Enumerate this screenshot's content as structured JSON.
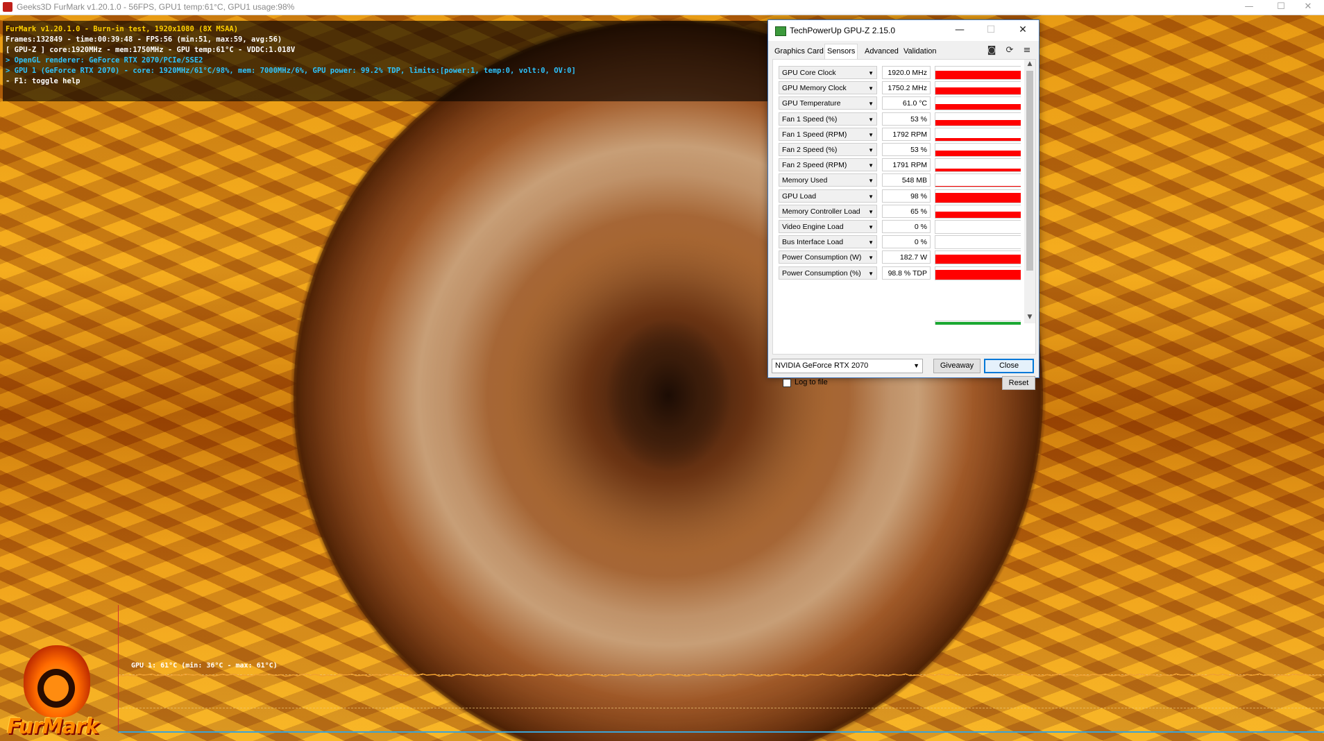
{
  "furmark": {
    "window_title": "Geeks3D FurMark v1.20.1.0 - 56FPS, GPU1 temp:61°C, GPU1 usage:98%",
    "osd": [
      {
        "text": "FurMark v1.20.1.0 - Burn-in test, 1920x1080 (8X MSAA)",
        "color": "#ffd000"
      },
      {
        "text": "Frames:132849 - time:00:39:48 - FPS:56 (min:51, max:59, avg:56)",
        "color": "#ffffff"
      },
      {
        "text": "[ GPU-Z ] core:1920MHz - mem:1750MHz - GPU temp:61°C - VDDC:1.018V",
        "color": "#ffffff"
      },
      {
        "text": "> OpenGL renderer: GeForce RTX 2070/PCIe/SSE2",
        "color": "#2ec4ff"
      },
      {
        "text": "> GPU 1 (GeForce RTX 2070) - core: 1920MHz/61°C/98%, mem: 7000MHz/6%, GPU power: 99.2% TDP, limits:[power:1, temp:0, volt:0, OV:0]",
        "color": "#2ec4ff"
      },
      {
        "text": "- F1: toggle help",
        "color": "#ffffff"
      }
    ],
    "graph_label": "GPU 1: 61°C (min: 36°C - max: 61°C)",
    "logo_text": "FurMark",
    "graph_color": "#f0a030"
  },
  "gpuz": {
    "title": "TechPowerUp GPU-Z 2.15.0",
    "tabs": [
      {
        "label": "Graphics Card",
        "active": false
      },
      {
        "label": "Sensors",
        "active": true
      },
      {
        "label": "Advanced",
        "active": false
      },
      {
        "label": "Validation",
        "active": false
      }
    ],
    "toolbar_icons": [
      "camera-icon",
      "refresh-icon",
      "menu-icon"
    ],
    "sensors": [
      {
        "name": "GPU Core Clock",
        "value": "1920.0 MHz",
        "level": 0.65
      },
      {
        "name": "GPU Memory Clock",
        "value": "1750.2 MHz",
        "level": 0.55
      },
      {
        "name": "GPU Temperature",
        "value": "61.0 °C",
        "level": 0.45
      },
      {
        "name": "Fan 1 Speed (%)",
        "value": "53 %",
        "level": 0.45
      },
      {
        "name": "Fan 1 Speed (RPM)",
        "value": "1792 RPM",
        "level": 0.2
      },
      {
        "name": "Fan 2 Speed (%)",
        "value": "53 %",
        "level": 0.45
      },
      {
        "name": "Fan 2 Speed (RPM)",
        "value": "1791 RPM",
        "level": 0.2
      },
      {
        "name": "Memory Used",
        "value": "548 MB",
        "level": 0.06
      },
      {
        "name": "GPU Load",
        "value": "98 %",
        "level": 0.8
      },
      {
        "name": "Memory Controller Load",
        "value": "65 %",
        "level": 0.5
      },
      {
        "name": "Video Engine Load",
        "value": "0 %",
        "level": 0
      },
      {
        "name": "Bus Interface Load",
        "value": "0 %",
        "level": 0
      },
      {
        "name": "Power Consumption (W)",
        "value": "182.7 W",
        "level": 0.7
      },
      {
        "name": "Power Consumption (%)",
        "value": "98.8 % TDP",
        "level": 0.8
      }
    ],
    "log_to_file": {
      "label": "Log to file",
      "checked": false
    },
    "reset_label": "Reset",
    "gpu_selected": "NVIDIA GeForce RTX 2070",
    "giveaway_label": "Giveaway",
    "close_label": "Close",
    "graph_fill_color": "#ff0000",
    "partial_bar_color": "#1aa832"
  }
}
